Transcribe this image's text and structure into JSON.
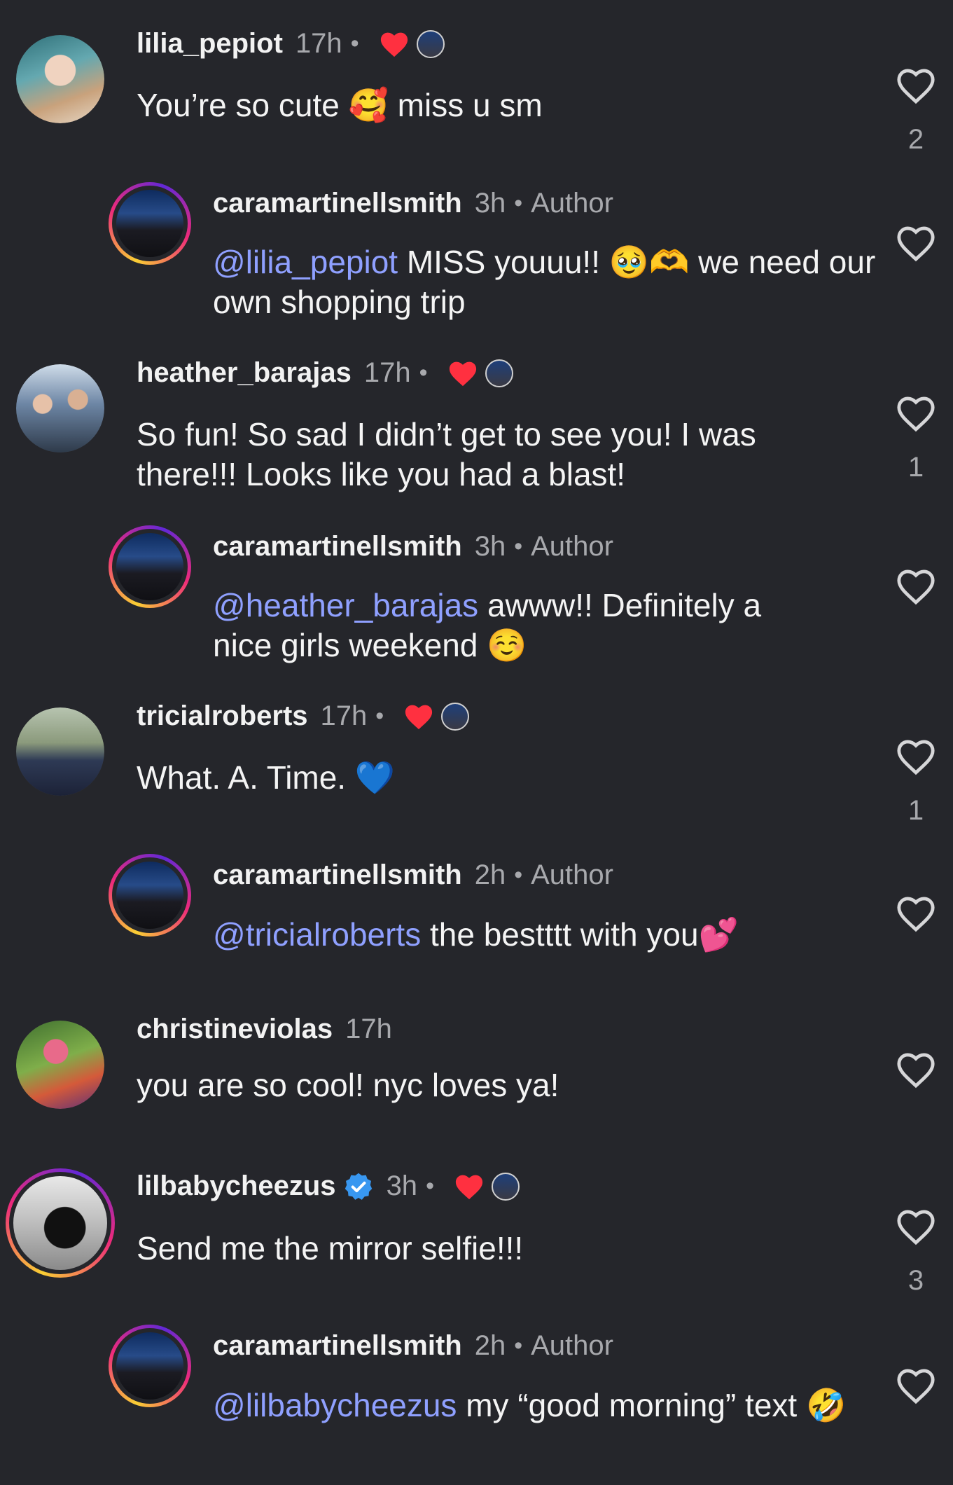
{
  "comments": [
    {
      "username": "lilia_pepiot",
      "time": "17h",
      "text": "You’re so cute 🥰 miss u sm",
      "likes": "2",
      "liked_by_author": true
    },
    {
      "username": "caramartinellsmith",
      "time": "3h",
      "badge": "Author",
      "mention": "@lilia_pepiot",
      "text": " MISS youuu!! 🥹🫶 we need our own shopping trip",
      "likes": ""
    },
    {
      "username": "heather_barajas",
      "time": "17h",
      "text": "So fun! So sad I didn’t get to see you! I was there!!! Looks like you had a blast!",
      "likes": "1",
      "liked_by_author": true
    },
    {
      "username": "caramartinellsmith",
      "time": "3h",
      "badge": "Author",
      "mention": "@heather_barajas",
      "text": " awww!! Definitely a nice girls weekend ☺️",
      "likes": ""
    },
    {
      "username": "tricialroberts",
      "time": "17h",
      "text": "What. A. Time. 💙",
      "likes": "1",
      "liked_by_author": true
    },
    {
      "username": "caramartinellsmith",
      "time": "2h",
      "badge": "Author",
      "mention": "@tricialroberts",
      "text": " the bestttt with you💕",
      "likes": ""
    },
    {
      "username": "christineviolas",
      "time": "17h",
      "text": "you are so cool! nyc loves ya!",
      "likes": ""
    },
    {
      "username": "lilbabycheezus",
      "time": "3h",
      "text": "Send me the mirror selfie!!!",
      "likes": "3",
      "liked_by_author": true,
      "verified": true
    },
    {
      "username": "caramartinellsmith",
      "time": "2h",
      "badge": "Author",
      "mention": "@lilbabycheezus",
      "text": " my “good morning” text 🤣",
      "likes": ""
    }
  ],
  "separator": "•",
  "icons": {
    "like": "heart-outline-icon",
    "author_like": "heart-filled-icon",
    "verified": "verified-badge-icon"
  },
  "colors": {
    "background": "#25262b",
    "mention": "#8fa0ff",
    "heart": "#ff3040",
    "verified": "#3897f0"
  }
}
